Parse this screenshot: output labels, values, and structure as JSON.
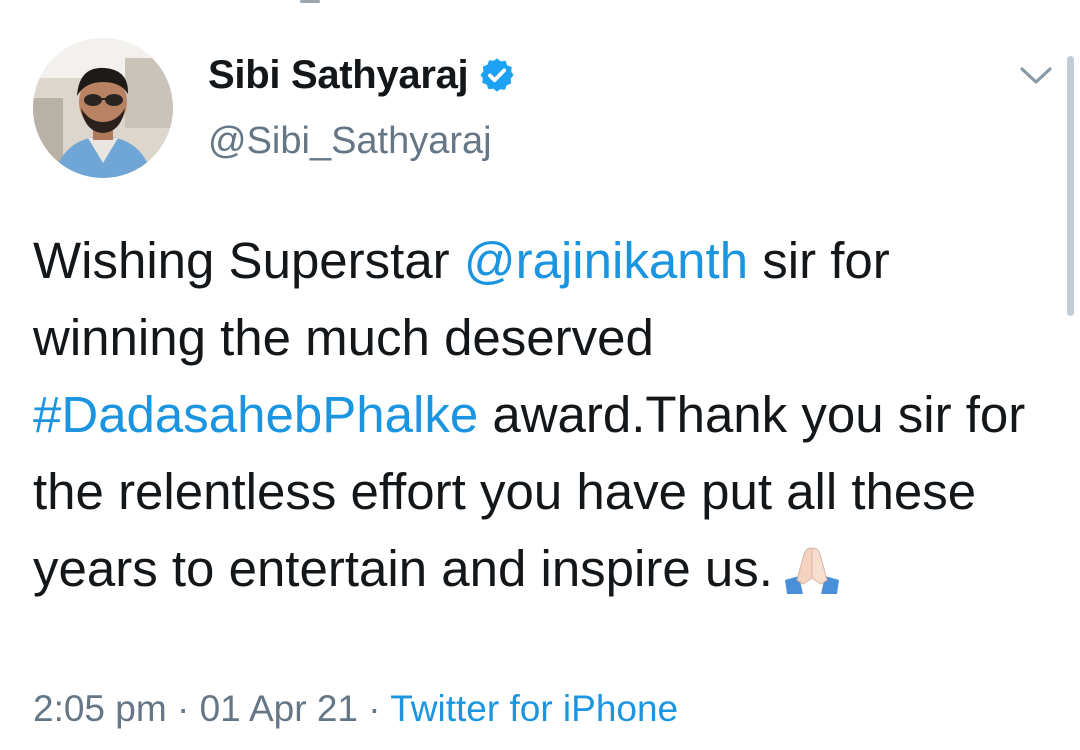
{
  "tweet": {
    "author": {
      "display_name": "Sibi Sathyaraj",
      "handle": "@Sibi_Sathyaraj",
      "verified": true,
      "avatar_icon": "profile-photo"
    },
    "body": {
      "part1": "Wishing Superstar ",
      "mention": "@rajinikanth",
      "part2": " sir for winning the much deserved ",
      "hashtag": "#DadasahebPhalke",
      "part3": " award.Thank you sir for the relentless effort you have put all these years to entertain and inspire us.",
      "emoji": "folded-hands-emoji"
    },
    "meta": {
      "time": "2:05 pm",
      "separator": " · ",
      "date": "01 Apr 21",
      "source": "Twitter for iPhone"
    }
  },
  "colors": {
    "text": "#14171a",
    "secondary": "#657786",
    "link": "#1b95e0",
    "verified_badge": "#1da1f2"
  }
}
